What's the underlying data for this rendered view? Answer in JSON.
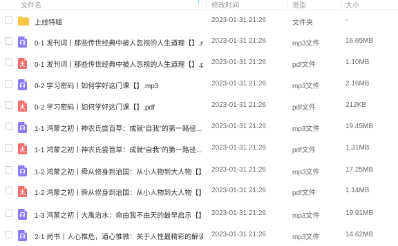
{
  "header": {
    "name": "文件名",
    "time": "修改时间",
    "type": "类型",
    "size": "大小"
  },
  "colors": {
    "folder": "#f7c544",
    "mp3": "#8b7cf6",
    "pdf": "#f26d6d",
    "accent": "#3b8cff"
  },
  "files": [
    {
      "icon": "folder",
      "name": "上线特辑",
      "time": "2023-01-31 21:26",
      "type": "文件夹",
      "size": "-"
    },
    {
      "icon": "mp3",
      "name": "0-1 发刊词丨那些传世经典中被人忽视的人生道理【】.m...",
      "time": "2023-01-31 21:26",
      "type": "mp3文件",
      "size": "16.65MB"
    },
    {
      "icon": "pdf",
      "name": "0-1 发刊词丨那些传世经典中被人忽视的人生道理【】.pdf",
      "time": "2023-01-31 21:26",
      "type": "pdf文件",
      "size": "1.10MB"
    },
    {
      "icon": "mp3",
      "name": "0-2 学习密码丨如何学好这门课【】.mp3",
      "time": "2023-01-31 21:26",
      "type": "mp3文件",
      "size": "2.16MB"
    },
    {
      "icon": "pdf",
      "name": "0-2 学习密码丨如何学好这门课【】.pdf",
      "time": "2023-01-31 21:26",
      "type": "pdf文件",
      "size": "212KB"
    },
    {
      "icon": "mp3",
      "name": "1-1 鸿蒙之初丨神农氏尝百草：成就“自我”的第一路径...",
      "time": "2023-01-31 21:26",
      "type": "mp3文件",
      "size": "19.45MB"
    },
    {
      "icon": "pdf",
      "name": "1-1 鸿蒙之初丨神农氏尝百草：成就“自我”的第一路径...",
      "time": "2023-01-31 21:26",
      "type": "pdf文件",
      "size": "1.31MB"
    },
    {
      "icon": "mp3",
      "name": "1-2 鸿蒙之初丨舜从修身到治国：从小人物到大人物【】...",
      "time": "2023-01-31 21:26",
      "type": "mp3文件",
      "size": "17.25MB"
    },
    {
      "icon": "pdf",
      "name": "1-2 鸿蒙之初丨舜从修身到治国：从小人物到大人物【】...",
      "time": "2023-01-31 21:26",
      "type": "pdf文件",
      "size": "1.14MB"
    },
    {
      "icon": "mp3",
      "name": "1-3 鸿蒙之初丨大禹治水：命由我不由天的最早启示【】...",
      "time": "2023-01-31 21:26",
      "type": "mp3文件",
      "size": "19.91MB"
    },
    {
      "icon": "mp3",
      "name": "2-1 尚书丨人心惟危，道心惟微：关于人性最精彩的解读...",
      "time": "2023-01-31 21:26",
      "type": "mp3文件",
      "size": "14.62MB"
    }
  ]
}
